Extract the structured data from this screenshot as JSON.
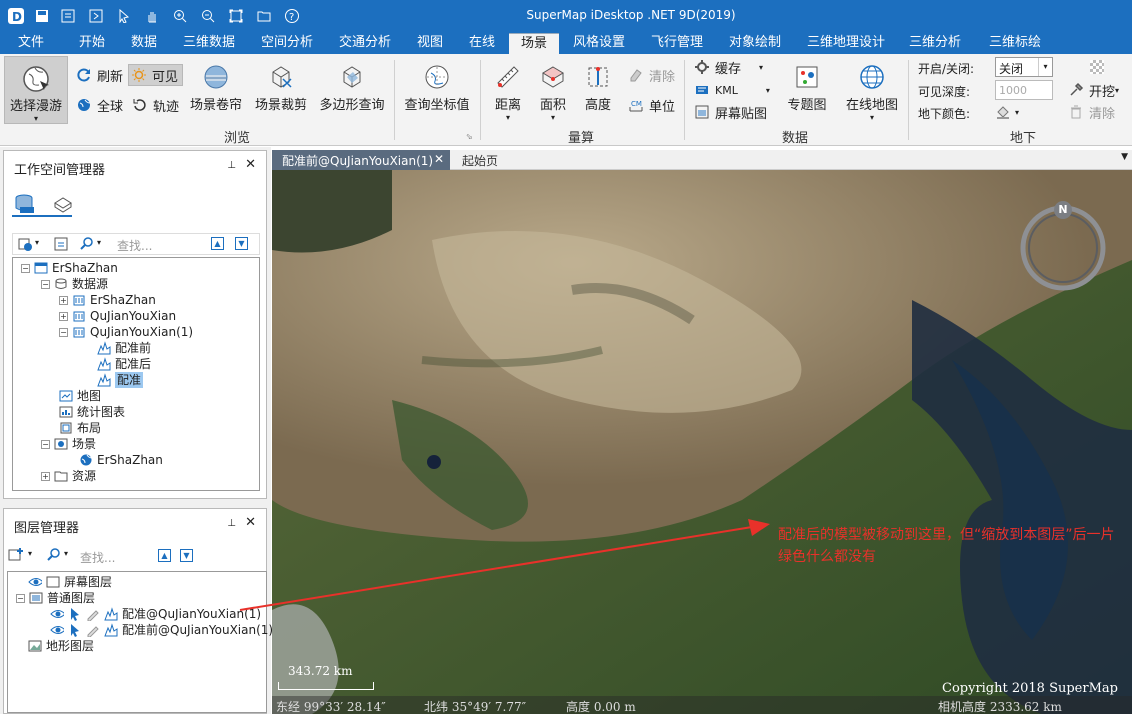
{
  "app": {
    "title": "SuperMap iDesktop .NET 9D(2019)"
  },
  "tabs": [
    "文件",
    "开始",
    "数据",
    "三维数据",
    "空间分析",
    "交通分析",
    "视图",
    "在线",
    "场景",
    "风格设置",
    "飞行管理",
    "对象绘制",
    "三维地理设计",
    "三维分析",
    "三维标绘"
  ],
  "ribbon": {
    "browse": {
      "roam": "选择漫游",
      "refresh": "刷新",
      "visible": "可见",
      "globe": "全球",
      "trace": "轨迹",
      "curtain": "场景卷帘",
      "clip": "场景裁剪",
      "polyquery": "多边形查询",
      "group": "浏览"
    },
    "querycoord": "查询坐标值",
    "measure": {
      "distance": "距离",
      "area": "面积",
      "height": "高度",
      "clear": "清除",
      "unit": "单位",
      "group": "量算"
    },
    "data": {
      "cache": "缓存",
      "kml": "KML",
      "screenpaste": "屏幕贴图",
      "thematic": "专题图",
      "online": "在线地图",
      "group": "数据"
    },
    "underground": {
      "onoff_label": "开启/关闭:",
      "onoff_value": "关闭",
      "depth_label": "可见深度:",
      "depth_value": "1000",
      "color_label": "地下颜色:",
      "dig": "开挖",
      "clear": "清除",
      "group": "地下"
    }
  },
  "workspace": {
    "title": "工作空间管理器",
    "search_placeholder": "查找...",
    "tree": {
      "root": "ErShaZhan",
      "datasources": "数据源",
      "ds1": "ErShaZhan",
      "ds2": "QuJianYouXian",
      "ds3": "QuJianYouXian(1)",
      "d1": "配准前",
      "d2": "配准后",
      "d3": "配准",
      "maps": "地图",
      "charts": "统计图表",
      "layouts": "布局",
      "scenes": "场景",
      "scene1": "ErShaZhan",
      "resources": "资源"
    }
  },
  "layers": {
    "title": "图层管理器",
    "search_placeholder": "查找...",
    "screen": "屏幕图层",
    "normal": "普通图层",
    "l1": "配准@QuJianYouXian(1)",
    "l2": "配准前@QuJianYouXian(1)",
    "terrain": "地形图层"
  },
  "doctabs": {
    "active": "配准前@QuJianYouXian(1)",
    "other": "起始页"
  },
  "map": {
    "compass": "N",
    "scale": "343.72 km",
    "status": {
      "lon": "东经 99°33′ 28.14″",
      "lat": "北纬 35°49′ 7.77″",
      "alt": "高度 0.00 m",
      "cam": "相机高度 2333.62 km"
    },
    "copyright": "Copyright 2018 SuperMap",
    "annotation": "配准后的模型被移动到这里，但“缩放到本图层”后一片绿色什么都没有"
  },
  "colors": {
    "title_bar": "#1c6fbf",
    "annotation": "#e8312a"
  }
}
